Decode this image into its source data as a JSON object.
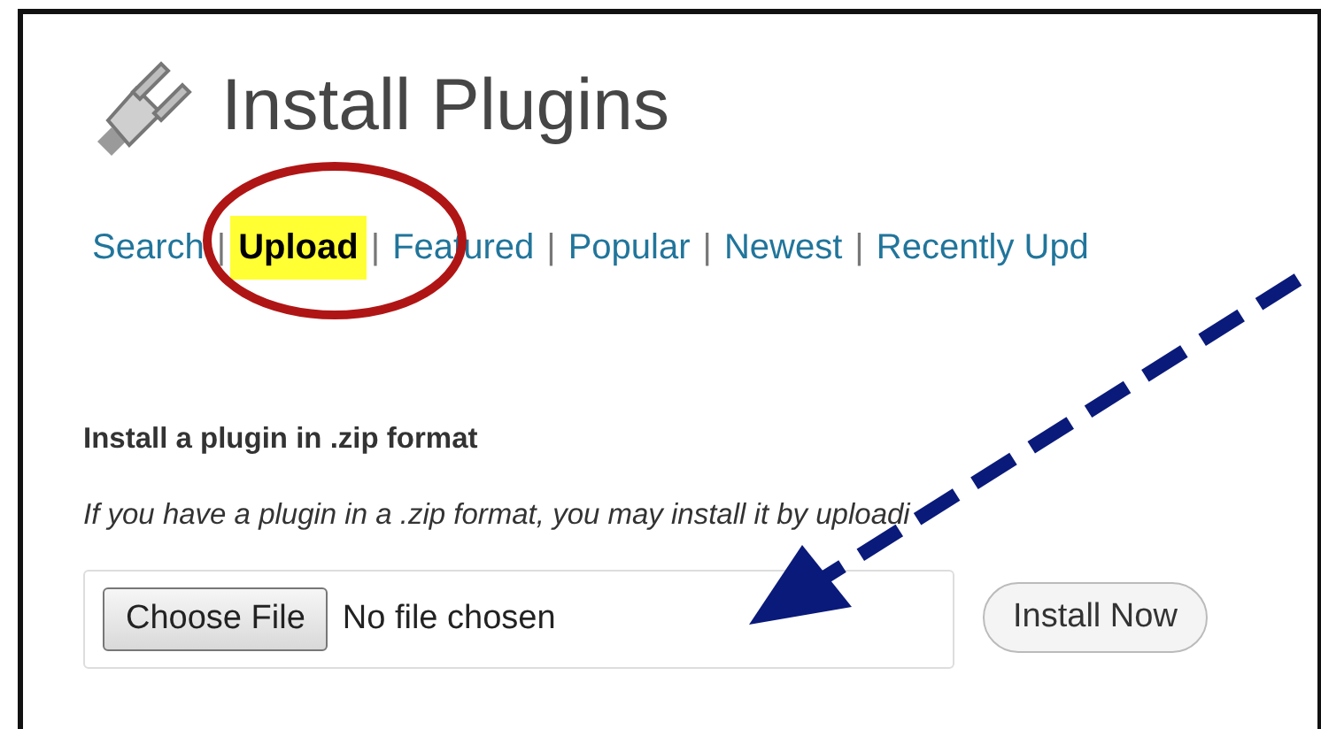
{
  "page": {
    "title": "Install Plugins"
  },
  "tabs": [
    {
      "label": "Search",
      "selected": false,
      "separator": "|"
    },
    {
      "label": "Upload",
      "selected": true,
      "separator": "|"
    },
    {
      "label": "Featured",
      "selected": false,
      "separator": "|"
    },
    {
      "label": "Popular",
      "selected": false,
      "separator": "|"
    },
    {
      "label": "Newest",
      "selected": false,
      "separator": "|"
    },
    {
      "label": "Recently Upd",
      "selected": false
    }
  ],
  "upload": {
    "heading": "Install a plugin in .zip format",
    "description": "If you have a plugin in a .zip format, you may install it by uploadi",
    "choose_button": "Choose File",
    "file_status": "No file chosen",
    "install_button": "Install Now"
  }
}
